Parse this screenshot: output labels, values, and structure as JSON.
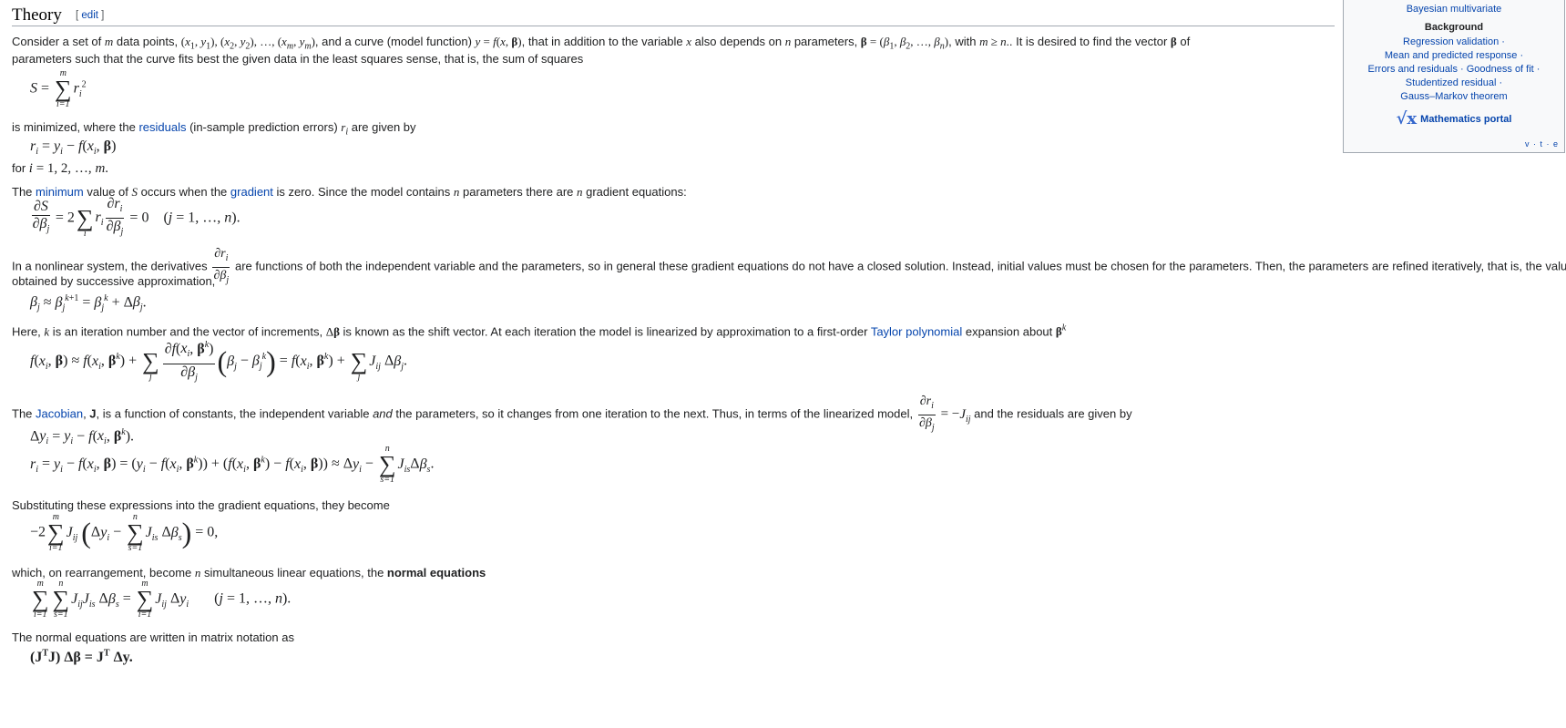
{
  "heading": {
    "title": "Theory",
    "edit_label": "edit",
    "bracket_open": "[",
    "bracket_close": "]"
  },
  "navbox": {
    "top_link": "Bayesian multivariate",
    "section_header": "Background",
    "lines": [
      "Regression validation ·",
      "Mean and predicted response ·",
      "Errors and residuals · Goodness of fit ·",
      "Studentized residual ·",
      "Gauss–Markov theorem"
    ],
    "portal_label": "Mathematics portal",
    "vte": "v · t · e"
  },
  "paragraphs": {
    "p1_a": "Consider a set of ",
    "p1_b": " data points, ",
    "p1_c": ", and a curve (model function) ",
    "p1_d": ", that in addition to the variable ",
    "p1_e": " also depends on ",
    "p1_f": " parameters, ",
    "p1_g": ", with ",
    "p1_h": ". It is desired to find the vector ",
    "p1_i": " of",
    "p1_line2": "parameters such that the curve fits best the given data in the least squares sense, that is, the sum of squares",
    "p2_a": "is minimized, where the ",
    "p2_link": "residuals",
    "p2_b": " (in-sample prediction errors) ",
    "p2_c": " are given by",
    "p3_a": "for ",
    "p4_a": "The ",
    "p4_link1": "minimum",
    "p4_b": " value of ",
    "p4_c": " occurs when the ",
    "p4_link2": "gradient",
    "p4_d": " is zero. Since the model contains ",
    "p4_e": " parameters there are ",
    "p4_f": " gradient equations:",
    "p5_a": "In a nonlinear system, the derivatives ",
    "p5_b": " are functions of both the independent variable and the parameters, so in general these gradient equations do not have a closed solution. Instead, initial values must be chosen for the parameters. Then, the parameters are refined iteratively, that is, the values are",
    "p5_line2": "obtained by successive approximation,",
    "p6_a": "Here, ",
    "p6_b": " is an iteration number and the vector of increments, ",
    "p6_c": " is known as the shift vector. At each iteration the model is linearized by approximation to a first-order ",
    "p6_link": "Taylor polynomial",
    "p6_d": " expansion about ",
    "p7_a": "The ",
    "p7_link": "Jacobian",
    "p7_b": ", ",
    "p7_J": "J",
    "p7_c": ", is a function of constants, the independent variable ",
    "p7_and": "and",
    "p7_d": " the parameters, so it changes from one iteration to the next. Thus, in terms of the linearized model, ",
    "p7_e": " and the residuals are given by",
    "p8": "Substituting these expressions into the gradient equations, they become",
    "p9_a": "which, on rearrangement, become ",
    "p9_b": " simultaneous linear equations, the ",
    "p9_bold": "normal equations",
    "p10": "The normal equations are written in matrix notation as"
  }
}
